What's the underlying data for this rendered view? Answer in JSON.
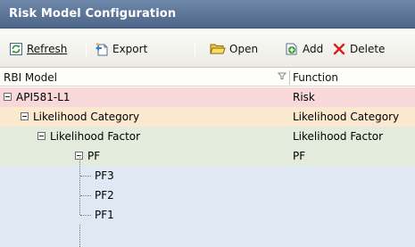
{
  "window": {
    "title": "Risk Model Configuration"
  },
  "toolbar": {
    "refresh_label": "Refresh",
    "export_label": "Export",
    "open_label": "Open",
    "add_label": "Add",
    "delete_label": "Delete"
  },
  "grid": {
    "columns": [
      "RBI Model",
      "Function"
    ],
    "rows": [
      {
        "name": "API581-L1",
        "function": "Risk",
        "level": 0,
        "expanded": true,
        "color": "#f8d8d8"
      },
      {
        "name": "Likelihood Category",
        "function": "Likelihood Category",
        "level": 1,
        "expanded": true,
        "color": "#fbe9cf"
      },
      {
        "name": "Likelihood Factor",
        "function": "Likelihood Factor",
        "level": 2,
        "expanded": true,
        "color": "#e3ecdc"
      },
      {
        "name": "PF",
        "function": "PF",
        "level": 3,
        "expanded": true,
        "color": "#e3ecdc"
      },
      {
        "name": "PF3",
        "function": "",
        "level": 4,
        "expanded": null,
        "color": "#dfe8f3"
      },
      {
        "name": "PF2",
        "function": "",
        "level": 4,
        "expanded": null,
        "color": "#dfe8f3"
      },
      {
        "name": "PF1",
        "function": "",
        "level": 4,
        "expanded": null,
        "color": "#dfe8f3"
      }
    ]
  },
  "colors": {
    "titlebar": "#5a7396",
    "risk_row": "#f8d8d8",
    "category_row": "#fbe9cf",
    "factor_row": "#e3ecdc",
    "leaf_row": "#dfe8f3"
  }
}
